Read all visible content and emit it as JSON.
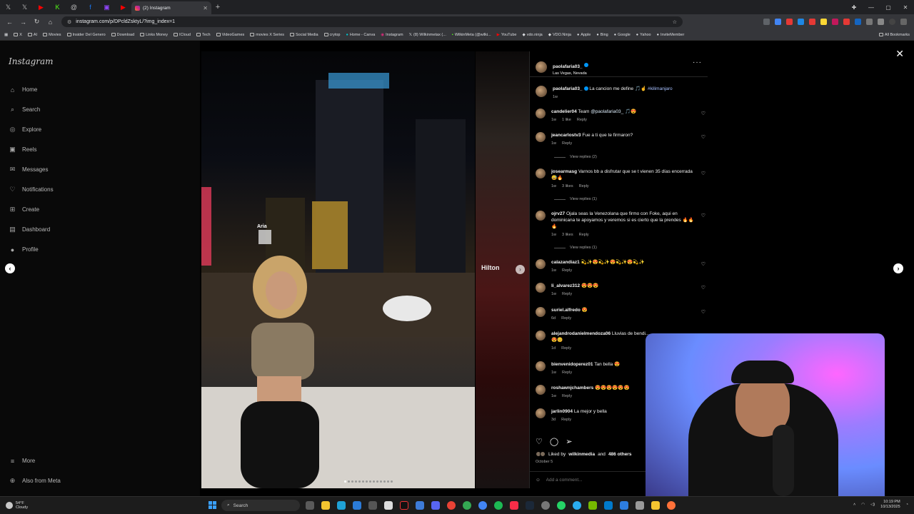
{
  "browser": {
    "active_tab_title": "(2) Instagram",
    "address": "instagram.com/p/DPcldZsktyL/?img_index=1",
    "bookmarks": [
      "X",
      "AI",
      "Movies",
      "Insider Del Genero",
      "Download",
      "Links Money",
      "ICloud",
      "Tech",
      "VideoGames",
      "movies X Series",
      "Social Media",
      "crytop",
      "Home - Canva",
      "Instagram",
      "(8) Wilkinmetax (...",
      "WilkinMeta (@wilki...",
      "YouTube",
      "vdo.ninja",
      "VDO.Ninja",
      "Apple",
      "Bing",
      "Google",
      "Yahoo",
      "InviteMember"
    ],
    "all_bookmarks": "All Bookmarks"
  },
  "sidebar": {
    "logo": "Instagram",
    "items": [
      {
        "label": "Home",
        "icon": "home-icon"
      },
      {
        "label": "Search",
        "icon": "search-icon"
      },
      {
        "label": "Explore",
        "icon": "compass-icon"
      },
      {
        "label": "Reels",
        "icon": "reels-icon"
      },
      {
        "label": "Messages",
        "icon": "messenger-icon"
      },
      {
        "label": "Notifications",
        "icon": "heart-icon"
      },
      {
        "label": "Create",
        "icon": "plus-square-icon"
      },
      {
        "label": "Dashboard",
        "icon": "dashboard-icon"
      },
      {
        "label": "Profile",
        "icon": "profile-icon"
      }
    ],
    "more": "More",
    "also_from_meta": "Also from Meta"
  },
  "post": {
    "author": "paolafaria03_",
    "location": "Las Vegas, Nevada",
    "caption": {
      "user": "paolafaria03_",
      "text": "La cancion me define 🎵☝",
      "hashtag": "#kilimanjaro",
      "time": "1w"
    },
    "comments": [
      {
        "user": "candelier04",
        "text": "Team",
        "mention": "@paolafaria03_",
        "tail": "🎵😍",
        "time": "1w",
        "likes": "1 like",
        "reply": "Reply"
      },
      {
        "user": "jeancarlostv3",
        "text": "Fue a ti que te firmaron?",
        "time": "1w",
        "reply": "Reply",
        "view_replies": "View replies (2)"
      },
      {
        "user": "josearmasg",
        "text": "Varnos bb a disfrutar que se t vienen 35 días encerrada 😅🔥",
        "time": "1w",
        "likes": "3 likes",
        "reply": "Reply",
        "view_replies": "View replies (1)"
      },
      {
        "user": "ojrv27",
        "text": "Ojala seas la Venezolana que firmo con Foke, aqui en dominicana te apoyamos y veremos si es cierto que la prendes 🔥🔥🔥",
        "time": "1w",
        "likes": "3 likes",
        "reply": "Reply",
        "view_replies": "View replies (1)"
      },
      {
        "user": "calazandiaz1",
        "text": "💫✨😍💫✨😍💫✨😍💫✨",
        "time": "1w",
        "reply": "Reply"
      },
      {
        "user": "li_alvarez312",
        "text": "😍😍😍",
        "time": "1w",
        "reply": "Reply"
      },
      {
        "user": "suriel.alfredo",
        "text": "😍",
        "time": "6d",
        "reply": "Reply"
      },
      {
        "user": "alejandrodanielmendoza06",
        "text": "Lluvias de bendi...",
        "tail2": "😍😊",
        "time": "1d",
        "reply": "Reply"
      },
      {
        "user": "bienvenidoperez01",
        "text": "Tan bella 😍",
        "time": "1w",
        "reply": "Reply"
      },
      {
        "user": "roshawnjchambers",
        "text": "😍😍😍😍😍😍",
        "time": "1w",
        "reply": "Reply"
      },
      {
        "user": "jarlin0904",
        "text": "La mejor y bella",
        "time": "3d",
        "reply": "Reply"
      }
    ],
    "liked_by_prefix": "Liked by",
    "liked_by_user": "wilkinmedia",
    "liked_by_and": "and",
    "liked_by_others": "486 others",
    "date": "October 5",
    "add_comment_placeholder": "Add a comment...",
    "sign_text": "Hilton",
    "casino_text": "Aria"
  },
  "taskbar": {
    "temp": "54°F",
    "condition": "Cloudy",
    "search": "Search",
    "time": "10:19 PM",
    "date": "10/13/2025"
  },
  "colors": {
    "accent": "#0095f6",
    "bg": "#000000",
    "hashtag": "#a7c0ff"
  }
}
